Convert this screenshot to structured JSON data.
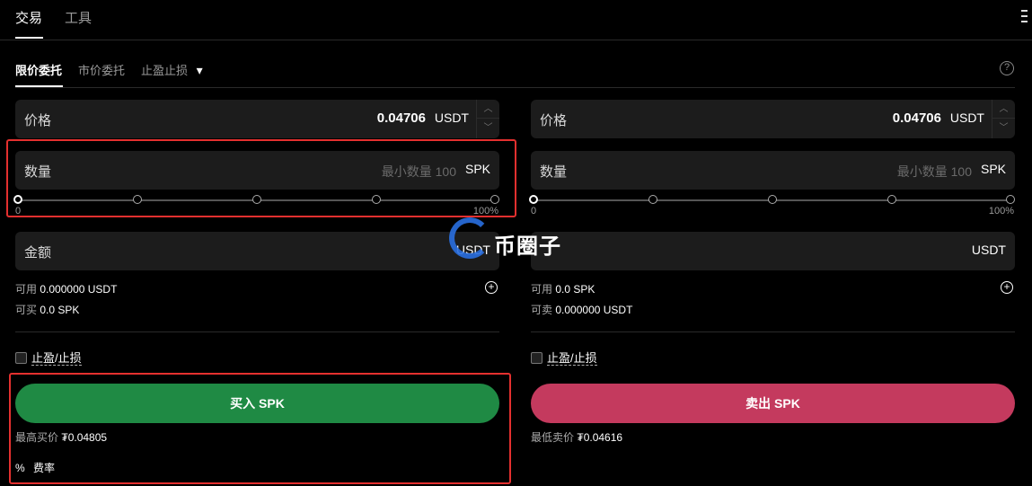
{
  "topnav": {
    "tabs": [
      {
        "label": "交易"
      },
      {
        "label": "工具"
      }
    ]
  },
  "subtabs": {
    "limit": "限价委托",
    "market": "市价委托",
    "tpsl": "止盈止损",
    "tpsl_arrow": "▾",
    "help": "?"
  },
  "buy": {
    "price_label": "价格",
    "price_value": "0.04706",
    "price_unit": "USDT",
    "qty_label": "数量",
    "qty_placeholder": "最小数量 100",
    "qty_unit": "SPK",
    "slider_min": "0",
    "slider_max": "100%",
    "slider_fraction": 0,
    "amount_label": "金额",
    "amount_unit": "USDT",
    "available_label": "可用",
    "available_value": "0.000000 USDT",
    "can_label": "可买",
    "can_value": "0.0 SPK",
    "tpsl_label": "止盈/止损",
    "button": "买入 SPK",
    "best_label": "最高买价",
    "best_value": "₮0.04805",
    "fee_icon": "%",
    "fee_label": "费率"
  },
  "sell": {
    "price_label": "价格",
    "price_value": "0.04706",
    "price_unit": "USDT",
    "qty_label": "数量",
    "qty_placeholder": "最小数量 100",
    "qty_unit": "SPK",
    "slider_min": "0",
    "slider_max": "100%",
    "slider_fraction": 0,
    "amount_unit": "USDT",
    "available_label": "可用",
    "available_value": "0.0 SPK",
    "can_label": "可卖",
    "can_value": "0.000000 USDT",
    "tpsl_label": "止盈/止损",
    "button": "卖出 SPK",
    "best_label": "最低卖价",
    "best_value": "₮0.04616"
  },
  "stepper": {
    "up": "︿",
    "down": "﹀"
  },
  "watermark": {
    "text": "币圈子"
  },
  "colors": {
    "buy": "#1f8a44",
    "sell": "#c43a5e",
    "highlight": "#e4302f",
    "watermark": "#2a6fe0"
  }
}
